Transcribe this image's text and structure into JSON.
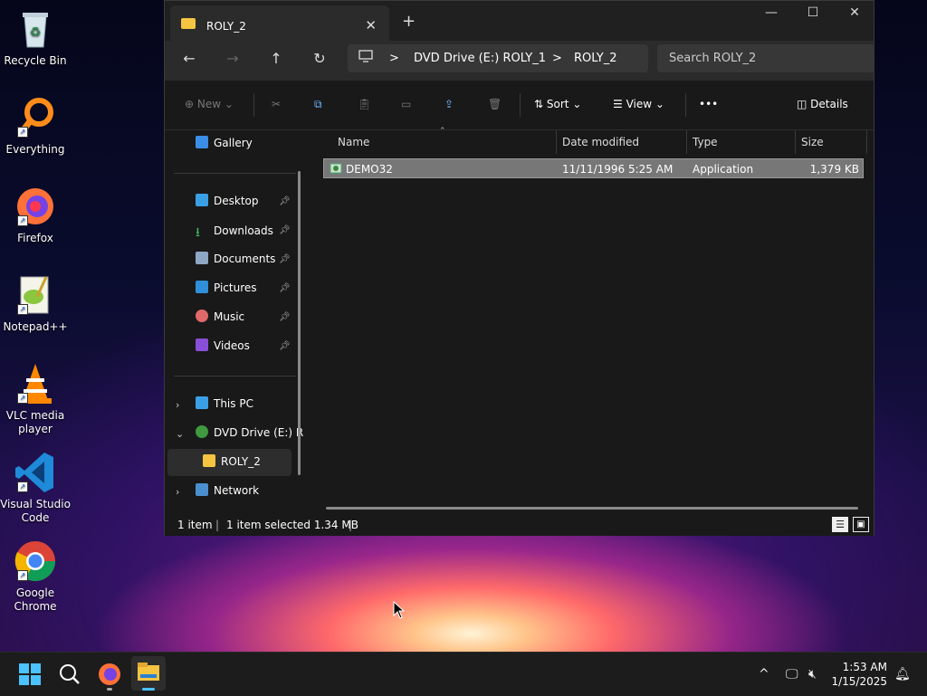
{
  "desktop": {
    "icons": [
      {
        "label": "Recycle Bin"
      },
      {
        "label": "Everything"
      },
      {
        "label": "Firefox"
      },
      {
        "label": "Notepad++"
      },
      {
        "label": "VLC media player"
      },
      {
        "label": "Visual Studio Code"
      },
      {
        "label": "Google Chrome"
      }
    ]
  },
  "window": {
    "tab_title": "ROLY_2",
    "tab_close": "✕",
    "new_tab": "+",
    "controls": {
      "minimize": "—",
      "maximize": "☐",
      "close": "✕"
    },
    "nav": {
      "back": "←",
      "forward": "→",
      "up": "↑",
      "refresh": "↻"
    },
    "address": {
      "sep1": ">",
      "crumb1": "DVD Drive (E:) ROLY_1",
      "sep2": ">",
      "crumb2": "ROLY_2"
    },
    "search_placeholder": "Search ROLY_2",
    "commands": {
      "new": "New",
      "sort": "Sort",
      "view": "View",
      "more": "•••",
      "details": "Details"
    },
    "navpane": {
      "gallery": "Gallery",
      "quick": [
        {
          "label": "Desktop"
        },
        {
          "label": "Downloads"
        },
        {
          "label": "Documents"
        },
        {
          "label": "Pictures"
        },
        {
          "label": "Music"
        },
        {
          "label": "Videos"
        }
      ],
      "this_pc": "This PC",
      "dvd": "DVD Drive (E:) R",
      "roly2": "ROLY_2",
      "network": "Network"
    },
    "columns": {
      "name": "Name",
      "date": "Date modified",
      "type": "Type",
      "size": "Size"
    },
    "files": [
      {
        "name": "DEMO32",
        "date": "11/11/1996 5:25 AM",
        "type": "Application",
        "size": "1,379 KB"
      }
    ],
    "status": {
      "count": "1 item",
      "selected": "1 item selected  1.34 MB"
    }
  },
  "taskbar": {
    "time": "1:53 AM",
    "date": "1/15/2025"
  },
  "colors": {
    "accent_blue": "#4aa3ff",
    "folder_yellow": "#f5c542",
    "selection": "#777777"
  }
}
